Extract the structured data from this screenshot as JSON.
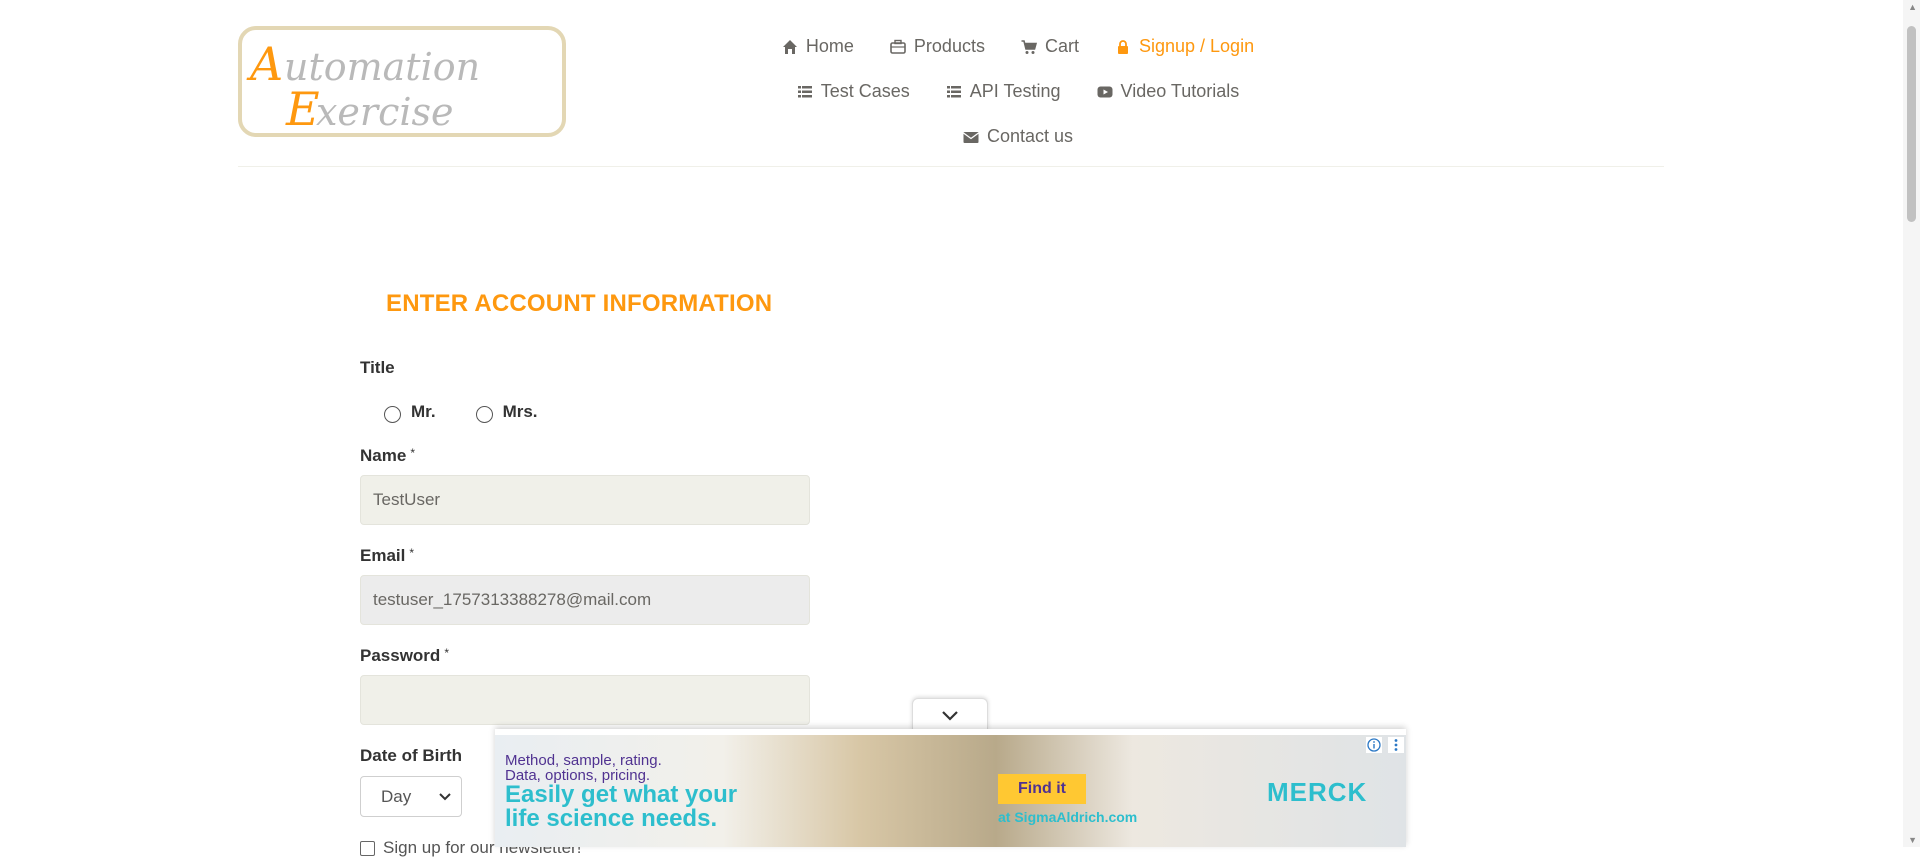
{
  "logo": {
    "text_line1": "Automation",
    "text_line2": "Exercise"
  },
  "nav": [
    {
      "label": "Home",
      "icon": "home-icon"
    },
    {
      "label": "Products",
      "icon": "briefcase-icon"
    },
    {
      "label": "Cart",
      "icon": "cart-icon"
    },
    {
      "label": "Signup / Login",
      "icon": "lock-icon",
      "active": true
    },
    {
      "label": "Test Cases",
      "icon": "list-icon"
    },
    {
      "label": "API Testing",
      "icon": "list-icon"
    },
    {
      "label": "Video Tutorials",
      "icon": "youtube-icon"
    },
    {
      "label": "Contact us",
      "icon": "envelope-icon"
    }
  ],
  "form": {
    "title": "ENTER ACCOUNT INFORMATION",
    "title_label": "Title",
    "title_options": [
      "Mr.",
      "Mrs."
    ],
    "name_label": "Name",
    "name_value": "TestUser",
    "email_label": "Email",
    "email_value": "testuser_1757313388278@mail.com",
    "password_label": "Password",
    "password_value": "",
    "required_marker": "*",
    "dob_label": "Date of Birth",
    "dob_day": "Day",
    "newsletter_label": "Sign up for our newsletter!"
  },
  "ad": {
    "line1": "Method, sample, rating.",
    "line2": "Data, options, pricing.",
    "headline1": "Easily get what your",
    "headline2": "life science needs.",
    "cta": "Find it",
    "site": "at SigmaAldrich.com",
    "brand": "MERCK"
  },
  "colors": {
    "accent": "#FE980F",
    "field_bg": "#F0F0E9",
    "text": "#696763"
  }
}
